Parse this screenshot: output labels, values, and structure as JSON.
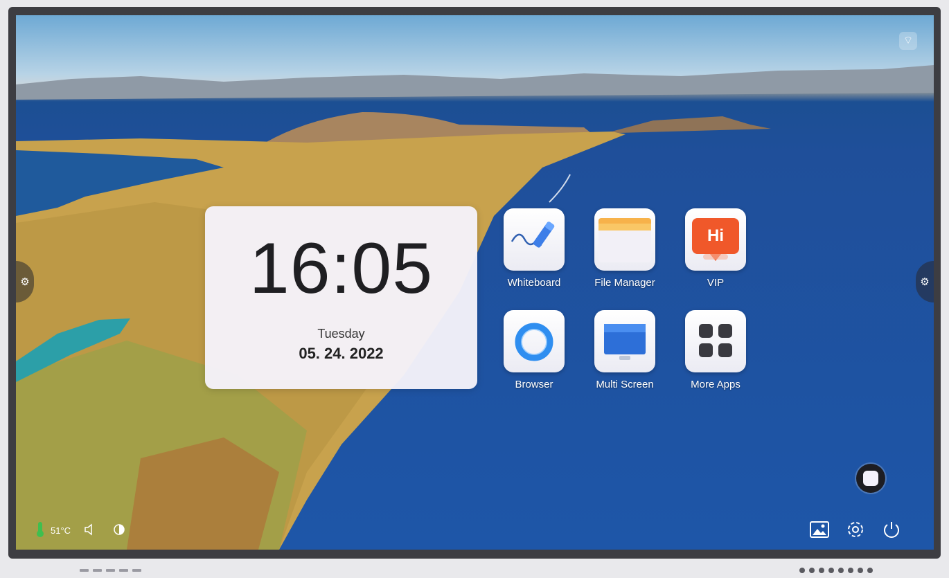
{
  "clock": {
    "time": "16:05",
    "day": "Tuesday",
    "date": "05. 24. 2022"
  },
  "apps": [
    {
      "label": "Whiteboard",
      "icon": "whiteboard-icon"
    },
    {
      "label": "File Manager",
      "icon": "folder-icon"
    },
    {
      "label": "VIP",
      "icon": "hi-chat-icon",
      "badge": "Hi"
    },
    {
      "label": "Browser",
      "icon": "browser-ring-icon"
    },
    {
      "label": "Multi Screen",
      "icon": "monitor-icon"
    },
    {
      "label": "More Apps",
      "icon": "app-grid-icon"
    }
  ],
  "status": {
    "temperature": "51°C"
  },
  "colors": {
    "accent_orange": "#f0582a",
    "folder_yellow": "#f7b24a",
    "browser_blue": "#2f8ef0"
  }
}
